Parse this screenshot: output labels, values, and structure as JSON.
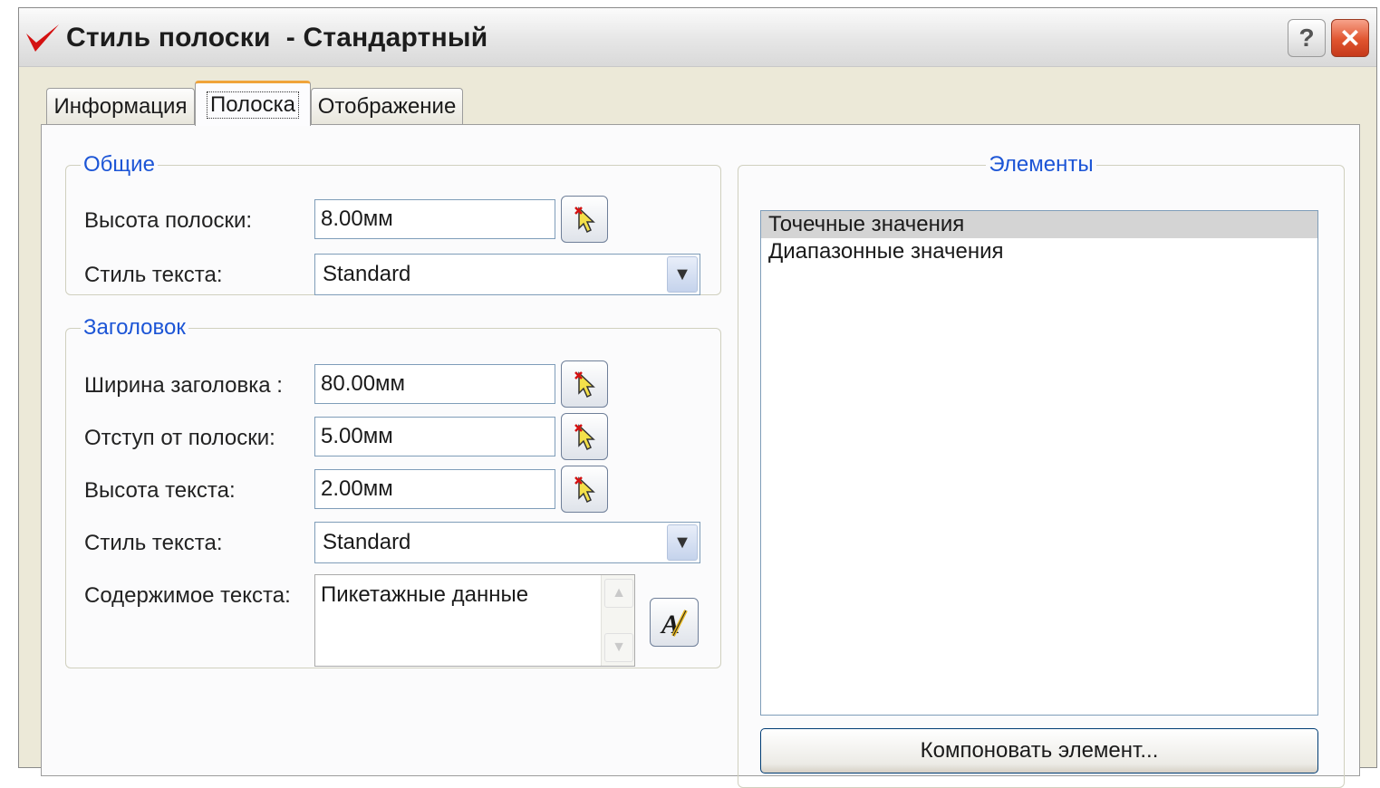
{
  "window": {
    "title": "Стиль полоски  - Стандартный",
    "help_label": "?",
    "close_label": "✕"
  },
  "tabs": [
    "Информация",
    "Полоска",
    "Отображение"
  ],
  "general": {
    "legend": "Общие",
    "strip_height_label": "Высота полоски:",
    "strip_height_value": "8.00мм",
    "text_style_label": "Стиль текста:",
    "text_style_value": "Standard"
  },
  "header": {
    "legend": "Заголовок",
    "width_label": "Ширина заголовка :",
    "width_value": "80.00мм",
    "offset_label": "Отступ от полоски:",
    "offset_value": "5.00мм",
    "text_height_label": "Высота текста:",
    "text_height_value": "2.00мм",
    "text_style_label": "Стиль текста:",
    "text_style_value": "Standard",
    "content_label": "Содержимое текста:",
    "content_value": "Пикетажные данные"
  },
  "elements": {
    "legend": "Элементы",
    "items": [
      "Точечные значения",
      "Диапазонные значения"
    ],
    "selected_index": 0,
    "compose_button": "Компоновать элемент..."
  },
  "icons": {
    "app": "red-checkmark-icon",
    "pick": "pick-pointer-icon",
    "text_editor": "text-editor-icon"
  },
  "colors": {
    "legend_text": "#1c55d6",
    "active_tab_accent": "#f0a43b",
    "close_button": "#e0542f"
  }
}
